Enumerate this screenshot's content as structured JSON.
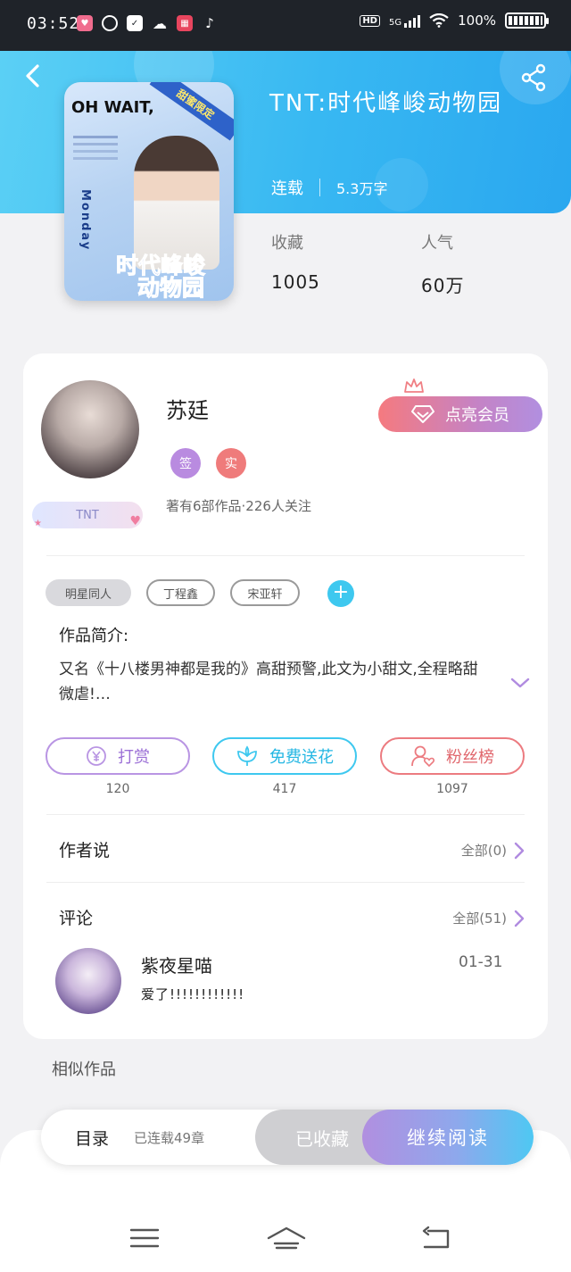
{
  "status_bar": {
    "time": "03:52",
    "network": "5G",
    "hd": "HD",
    "battery": "100%"
  },
  "book": {
    "title": "TNT:时代峰峻动物园",
    "status": "连载",
    "word_count": "5.3万字",
    "cover": {
      "headline": "OH WAIT,",
      "ribbon": "甜蜜限定",
      "title_line1": "时代峰峻",
      "title_line2": "动物园",
      "side_text": "Monday"
    },
    "stats": [
      {
        "label": "收藏",
        "value": "1005"
      },
      {
        "label": "人气",
        "value": "60万"
      }
    ]
  },
  "author": {
    "name": "苏廷",
    "badges": [
      "签",
      "实"
    ],
    "fan_badge": "TNT",
    "vip_button": "点亮会员",
    "stats_text": "著有6部作品·226人关注"
  },
  "tags": [
    "明星同人",
    "丁程鑫",
    "宋亚轩"
  ],
  "intro": {
    "label": "作品简介:",
    "text": "又名《十八楼男神都是我的》高甜预警,此文为小甜文,全程略甜微虐!…"
  },
  "actions": [
    {
      "label": "打赏",
      "count": "120",
      "color": "#b995e3"
    },
    {
      "label": "免费送花",
      "count": "417",
      "color": "#3ec8ef"
    },
    {
      "label": "粉丝榜",
      "count": "1097",
      "color": "#ec7b80"
    }
  ],
  "author_says": {
    "title": "作者说",
    "link": "全部(0)"
  },
  "comments": {
    "title": "评论",
    "link": "全部(51)",
    "items": [
      {
        "user": "紫夜星喵",
        "date": "01-31",
        "text": "爱了!!!!!!!!!!!!"
      }
    ]
  },
  "similar_title": "相似作品",
  "bottom_bar": {
    "toc": "目录",
    "chapters": "已连载49章",
    "favorited": "已收藏",
    "continue": "继续阅读"
  }
}
